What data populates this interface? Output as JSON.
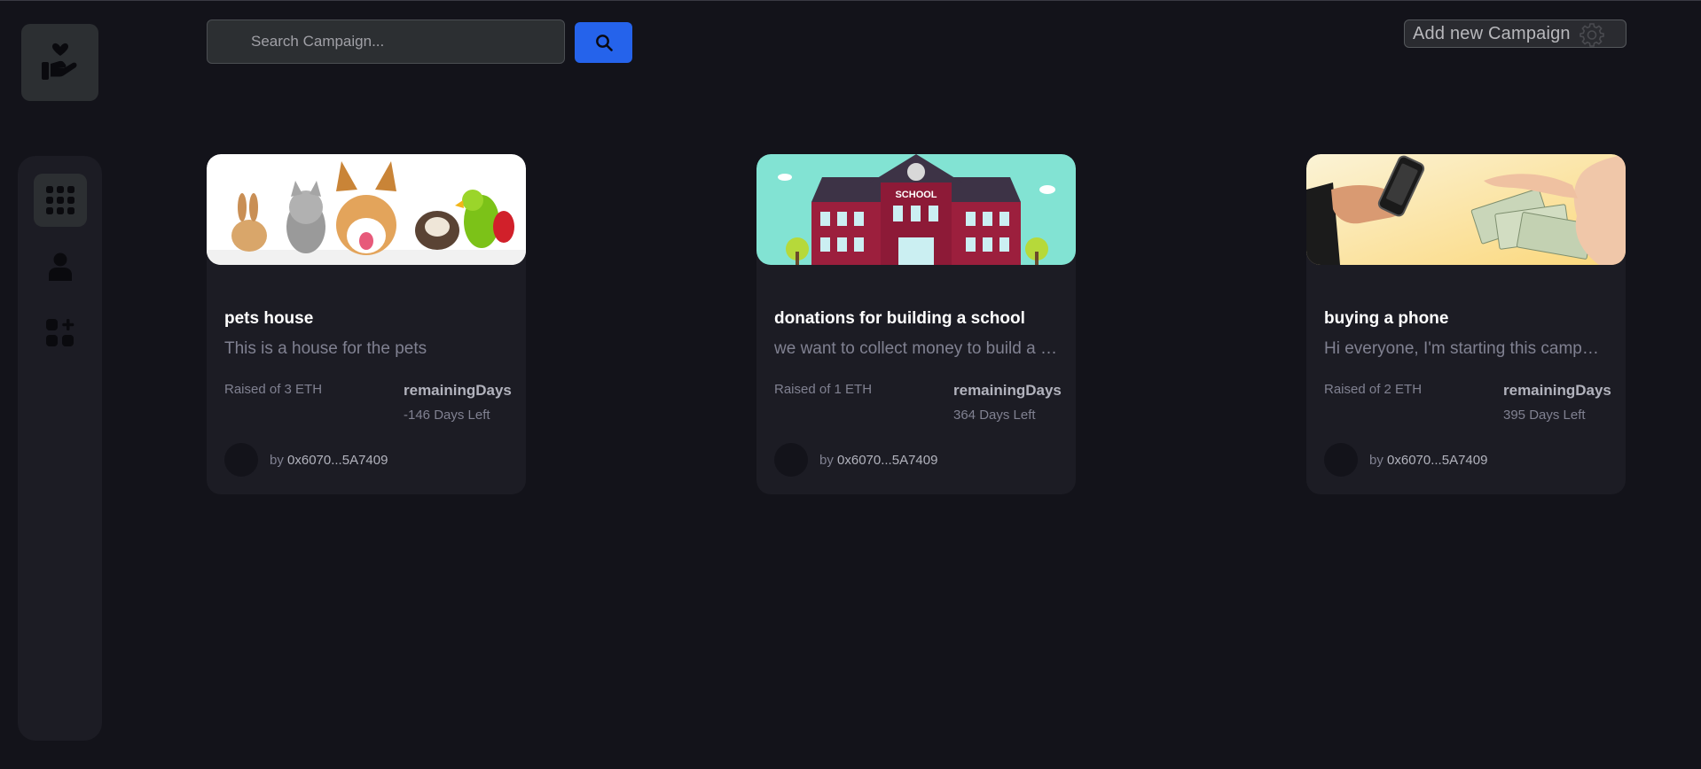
{
  "sidebar": {
    "logo_icon": "hand-heart-icon",
    "items": [
      {
        "icon": "dashboard-grid-icon",
        "active": true
      },
      {
        "icon": "user-icon",
        "active": false
      },
      {
        "icon": "add-apps-icon",
        "active": false
      }
    ]
  },
  "header": {
    "search_placeholder": "Search Campaign...",
    "search_value": "",
    "search_button_icon": "search-icon",
    "add_campaign_label": "Add new Campaign",
    "add_campaign_icon": "gear-icon"
  },
  "campaigns": [
    {
      "image": "pets-photo",
      "title": "pets house",
      "description": "This is a house for the pets",
      "raised": "Raised of 3 ETH",
      "remaining_label": "remainingDays",
      "remaining_value": "-146 Days Left",
      "by": "by",
      "owner": "0x6070...5A7409"
    },
    {
      "image": "school-illustration",
      "title": "donations for building a school",
      "description": "we want to collect money to build a new school for the children",
      "raised": "Raised of 1 ETH",
      "remaining_label": "remainingDays",
      "remaining_value": "364 Days Left",
      "by": "by",
      "owner": "0x6070...5A7409",
      "image_text": "SCHOOL"
    },
    {
      "image": "phone-money-photo",
      "title": "buying a phone",
      "description": "Hi everyone, I'm starting this campaign to buy a phone",
      "raised": "Raised of 2 ETH",
      "remaining_label": "remainingDays",
      "remaining_value": "395 Days Left",
      "by": "by",
      "owner": "0x6070...5A7409"
    }
  ],
  "colors": {
    "background": "#13131a",
    "panel": "#1c1c24",
    "accent": "#2563eb",
    "muted_text": "#808191"
  }
}
